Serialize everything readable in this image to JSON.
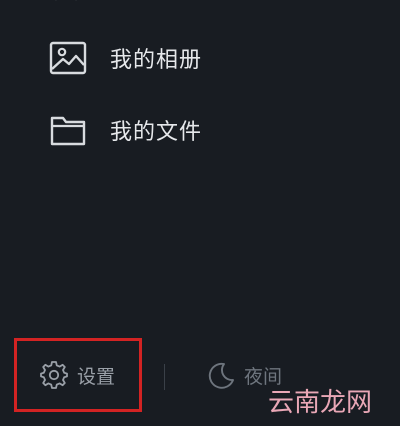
{
  "menu": {
    "items": [
      {
        "label": "我的相册",
        "icon": "image-icon"
      },
      {
        "label": "我的文件",
        "icon": "folder-icon"
      }
    ]
  },
  "bottom": {
    "settings_label": "设置",
    "settings_icon": "gear-icon",
    "night_label": "夜间",
    "night_icon": "moon-icon"
  },
  "watermark": "云南龙网",
  "colors": {
    "background": "#181c22",
    "text": "#e6e8eb",
    "highlight": "#d32323",
    "watermark": "#e9a7b6"
  }
}
